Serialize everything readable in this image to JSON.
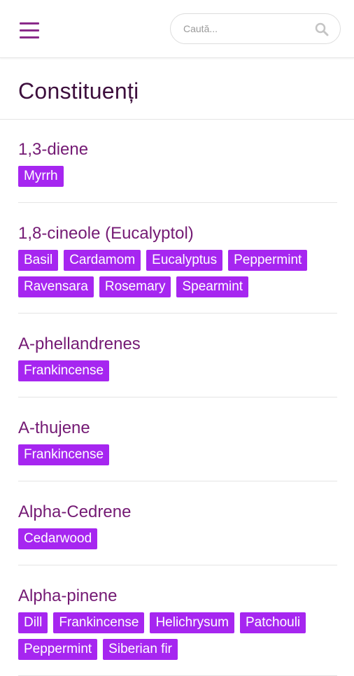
{
  "search": {
    "placeholder": "Caută..."
  },
  "page": {
    "title": "Constituenți"
  },
  "groups": [
    {
      "name": "1,3-diene",
      "tags": [
        "Myrrh"
      ]
    },
    {
      "name": "1,8-cineole (Eucalyptol)",
      "tags": [
        "Basil",
        "Cardamom",
        "Eucalyptus",
        "Peppermint",
        "Ravensara",
        "Rosemary",
        "Spearmint"
      ]
    },
    {
      "name": "A-phellandrenes",
      "tags": [
        "Frankincense"
      ]
    },
    {
      "name": "A-thujene",
      "tags": [
        "Frankincense"
      ]
    },
    {
      "name": "Alpha-Cedrene",
      "tags": [
        "Cedarwood"
      ]
    },
    {
      "name": "Alpha-pinene",
      "tags": [
        "Dill",
        "Frankincense",
        "Helichrysum",
        "Patchouli",
        "Peppermint",
        "Siberian fir"
      ]
    }
  ],
  "colors": {
    "accent": "#a626f0",
    "heading": "#741a74",
    "menu": "#8a2a8a"
  },
  "icons": {
    "menu": "hamburger-menu-icon",
    "search": "search-icon"
  }
}
